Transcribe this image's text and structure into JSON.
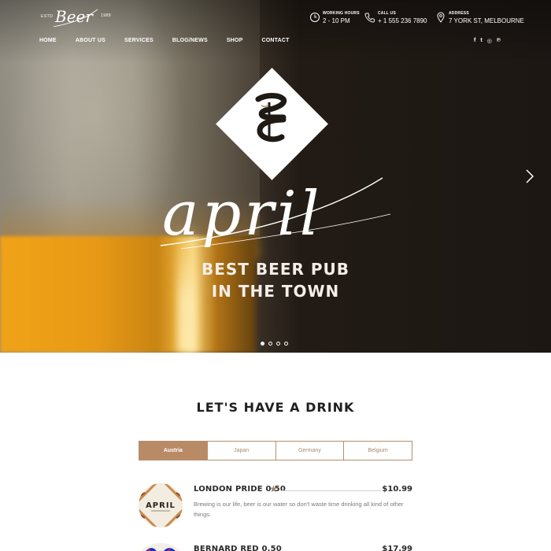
{
  "header": {
    "logo": {
      "estd": "ESTD",
      "brand": "Beer",
      "year": "1988"
    },
    "working_hours": {
      "label": "WORKING HOURS",
      "value": "2 - 10 PM"
    },
    "call": {
      "label": "CALL US",
      "value": "+ 1 555 236 7890"
    },
    "address": {
      "label": "ADDRESS",
      "value": "7 YORK ST, MELBOURNE"
    }
  },
  "nav": {
    "items": [
      "HOME",
      "ABOUT US",
      "SERVICES",
      "BLOG/NEWS",
      "SHOP",
      "CONTACT"
    ]
  },
  "social": {
    "items": [
      "facebook-icon",
      "twitter-icon",
      "instagram-icon",
      "pinterest-icon"
    ],
    "glyphs": [
      "f",
      "t",
      "◎",
      "℗"
    ]
  },
  "hero": {
    "script": "april",
    "tagline_line1": "BEST BEER PUB",
    "tagline_line2": "IN THE TOWN",
    "slides_total": 4,
    "slide_active": 1
  },
  "section": {
    "title": "LET'S HAVE A DRINK",
    "tabs": [
      "Austria",
      "Japan",
      "Germany",
      "Belgium"
    ],
    "active_tab": "Austria"
  },
  "drinks": [
    {
      "name": "LONDON PRIDE 0.50",
      "price": "$10.99",
      "featured": true,
      "description": "Brewing is our life, beer is our water so don't waste time drinking all kind of other things.",
      "thumb_label": "APRIL"
    },
    {
      "name": "BERNARD RED 0.50",
      "price": "$17.99",
      "featured": false,
      "description": "",
      "thumb_label": ""
    }
  ],
  "colors": {
    "accent": "#b98a66",
    "hero_dark": "#1c1713",
    "amber": "#f0a218"
  }
}
